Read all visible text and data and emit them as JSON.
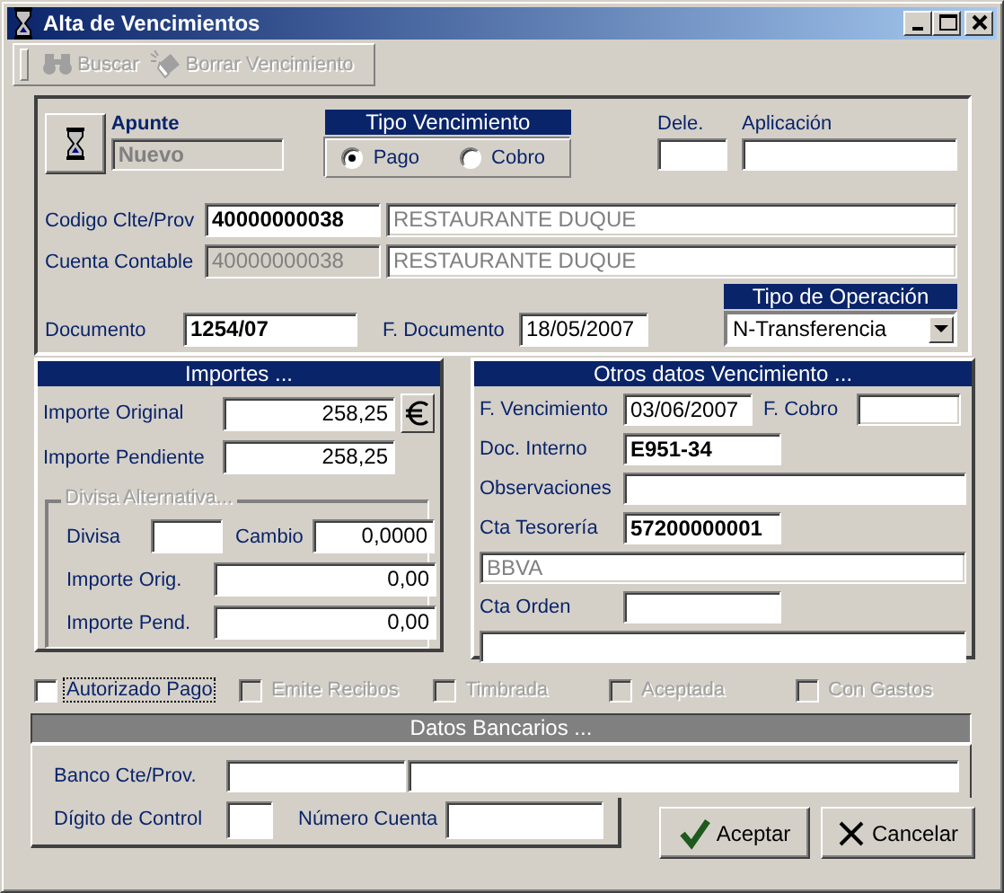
{
  "window": {
    "title": "Alta de Vencimientos"
  },
  "toolbar": [
    {
      "label": "Buscar",
      "kind": "binoculars",
      "disabled": true
    },
    {
      "label": "Borrar Vencimiento",
      "kind": "eraser",
      "disabled": true
    }
  ],
  "apunte": {
    "label": "Apunte",
    "value": "Nuevo",
    "disabled": true
  },
  "tipo_vencimiento": {
    "title": "Tipo Vencimiento",
    "options": [
      {
        "label": "Pago",
        "selected": true
      },
      {
        "label": "Cobro",
        "selected": false
      }
    ]
  },
  "dele": {
    "label": "Dele."
  },
  "aplicacion": {
    "label": "Aplicación"
  },
  "codigo": {
    "label": "Codigo Clte/Prov",
    "code": "40000000038",
    "code_disabled": false,
    "name": "RESTAURANTE DUQUE"
  },
  "cuenta": {
    "label": "Cuenta Contable",
    "code": "40000000038",
    "code_disabled": true,
    "name": "RESTAURANTE DUQUE"
  },
  "documento": {
    "label": "Documento",
    "value": "1254/07"
  },
  "f_documento": {
    "label": "F. Documento",
    "value": "18/05/2007"
  },
  "tipo_operacion": {
    "title": "Tipo de Operación",
    "value": "N-Transferencia"
  },
  "importes": {
    "title": "Importes ...",
    "original": {
      "label": "Importe Original",
      "value": "258,25"
    },
    "pendiente": {
      "label": "Importe Pendiente",
      "value": "258,25"
    },
    "divisa_alternativa": {
      "title": "Divisa Alternativa...",
      "divisa": {
        "label": "Divisa"
      },
      "cambio": {
        "label": "Cambio",
        "value": "0,0000"
      },
      "importe_orig": {
        "label": "Importe Orig.",
        "value": "0,00"
      },
      "importe_pend": {
        "label": "Importe Pend.",
        "value": "0,00"
      }
    }
  },
  "otros_datos": {
    "title": "Otros datos Vencimiento ...",
    "f_vencimiento": {
      "label": "F. Vencimiento",
      "value": "03/06/2007"
    },
    "f_cobro": {
      "label": "F. Cobro",
      "disabled": true
    },
    "doc_interno": {
      "label": "Doc. Interno",
      "value": "E951-34"
    },
    "observaciones": {
      "label": "Observaciones"
    },
    "cta_tesoreria": {
      "label": "Cta Tesorería",
      "value": "57200000001",
      "name": "BBVA"
    },
    "cta_orden": {
      "label": "Cta Orden"
    }
  },
  "checkboxes": [
    {
      "label": "Autorizado Pago",
      "checked": false,
      "disabled": false,
      "focused": true
    },
    {
      "label": "Emite Recibos",
      "checked": false,
      "disabled": true,
      "focused": false
    },
    {
      "label": "Timbrada",
      "checked": false,
      "disabled": true,
      "focused": false
    },
    {
      "label": "Aceptada",
      "checked": false,
      "disabled": true,
      "focused": false
    },
    {
      "label": "Con Gastos",
      "checked": false,
      "disabled": true,
      "focused": false
    }
  ],
  "datos_bancarios": {
    "title": "Datos Bancarios ...",
    "banco": {
      "label": "Banco Cte/Prov."
    },
    "digito": {
      "label": "Dígito de Control"
    },
    "numero": {
      "label": "Número Cuenta"
    }
  },
  "buttons": [
    {
      "label": "Aceptar",
      "kind": "check"
    },
    {
      "label": "Cancelar",
      "kind": "cross"
    }
  ]
}
